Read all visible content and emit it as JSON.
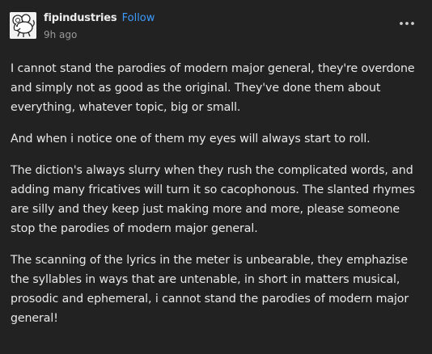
{
  "post": {
    "blog_name": "fipindustries",
    "follow_label": "Follow",
    "timestamp": "9h ago",
    "more_icon": "ellipsis-horizontal-icon",
    "paragraphs": [
      "I cannot stand the parodies of modern major general, they're overdone and simply not as good as the original. They've done them about everything, whatever topic, big or small.",
      "And when i notice one of them my eyes will always start to roll.",
      "The diction's always slurry when they rush the complicated words, and adding many fricatives will turn it so cacophonous. The slanted rhymes are silly and they keep just making more and more, please someone stop the parodies of modern major general.",
      "The scanning of the lyrics in the meter is unbearable, they emphazise the syllables in ways that are untenable, in short in matters musical, prosodic and ephemeral, i cannot stand the parodies of modern major general!"
    ]
  },
  "colors": {
    "background": "#222222",
    "text": "#e8e8e8",
    "follow": "#3d9bff",
    "muted": "#9a9a9a"
  }
}
